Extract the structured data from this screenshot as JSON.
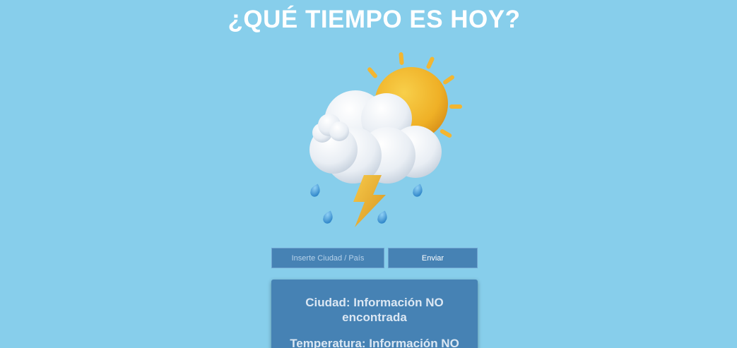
{
  "header": {
    "title": "¿QUÉ TIEMPO ES HOY?"
  },
  "illustration": {
    "icon": "cloud-sun-storm-icon"
  },
  "search": {
    "placeholder": "Inserte Ciudad / País",
    "value": "",
    "submit_label": "Enviar"
  },
  "result": {
    "city": "Ciudad: Información NO encontrada",
    "temperature": "Temperatura: Información NO"
  },
  "colors": {
    "background": "#87ceeb",
    "panel": "#4682b4",
    "title_text": "#ffffff"
  }
}
